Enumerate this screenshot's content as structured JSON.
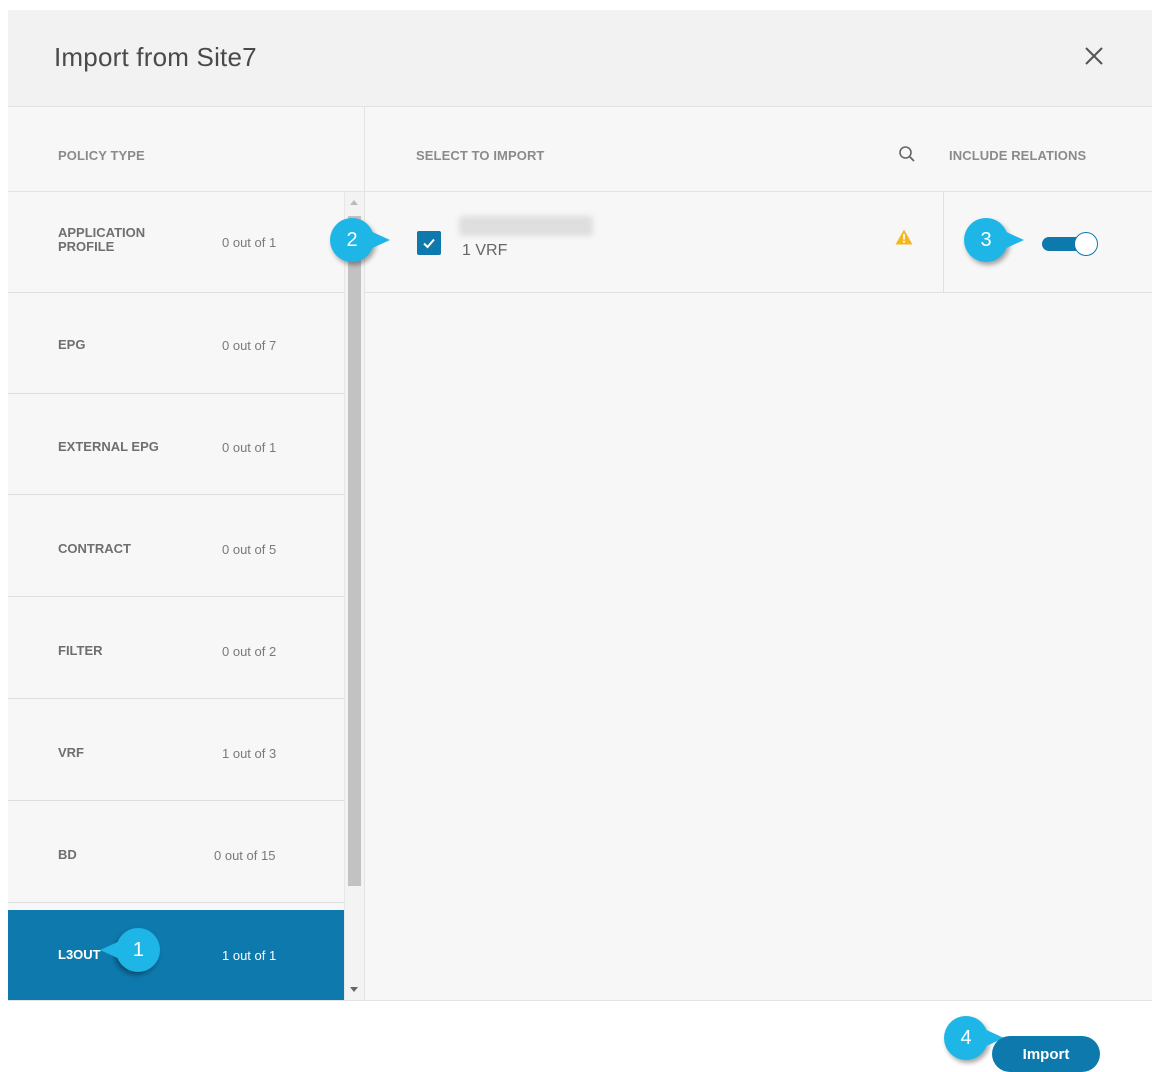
{
  "dialog": {
    "title": "Import from Site7",
    "close_icon": "close-icon"
  },
  "columns": {
    "policy_type": "POLICY TYPE",
    "select_to_import": "SELECT TO IMPORT",
    "include_relations": "INCLUDE RELATIONS"
  },
  "policy_types": [
    {
      "name_line1": "APPLICATION",
      "name_line2": "PROFILE",
      "count": "0 out of 1"
    },
    {
      "name_line1": "EPG",
      "name_line2": "",
      "count": "0 out of 7"
    },
    {
      "name_line1": "EXTERNAL EPG",
      "name_line2": "",
      "count": "0 out of 1"
    },
    {
      "name_line1": "CONTRACT",
      "name_line2": "",
      "count": "0 out of 5"
    },
    {
      "name_line1": "FILTER",
      "name_line2": "",
      "count": "0 out of 2"
    },
    {
      "name_line1": "VRF",
      "name_line2": "",
      "count": "1 out of 3"
    },
    {
      "name_line1": "BD",
      "name_line2": "",
      "count": "0 out of 15"
    },
    {
      "name_line1": "L3OUT",
      "name_line2": "",
      "count": "1 out of 1",
      "selected": true
    }
  ],
  "import_items": [
    {
      "checked": true,
      "subtitle": "1 VRF",
      "warning": true,
      "include_relations": true
    }
  ],
  "footer": {
    "import_label": "Import"
  },
  "callouts": [
    "1",
    "2",
    "3",
    "4"
  ],
  "colors": {
    "accent": "#0e79ad",
    "callout": "#1eb6e6",
    "warning": "#f5b71e"
  }
}
